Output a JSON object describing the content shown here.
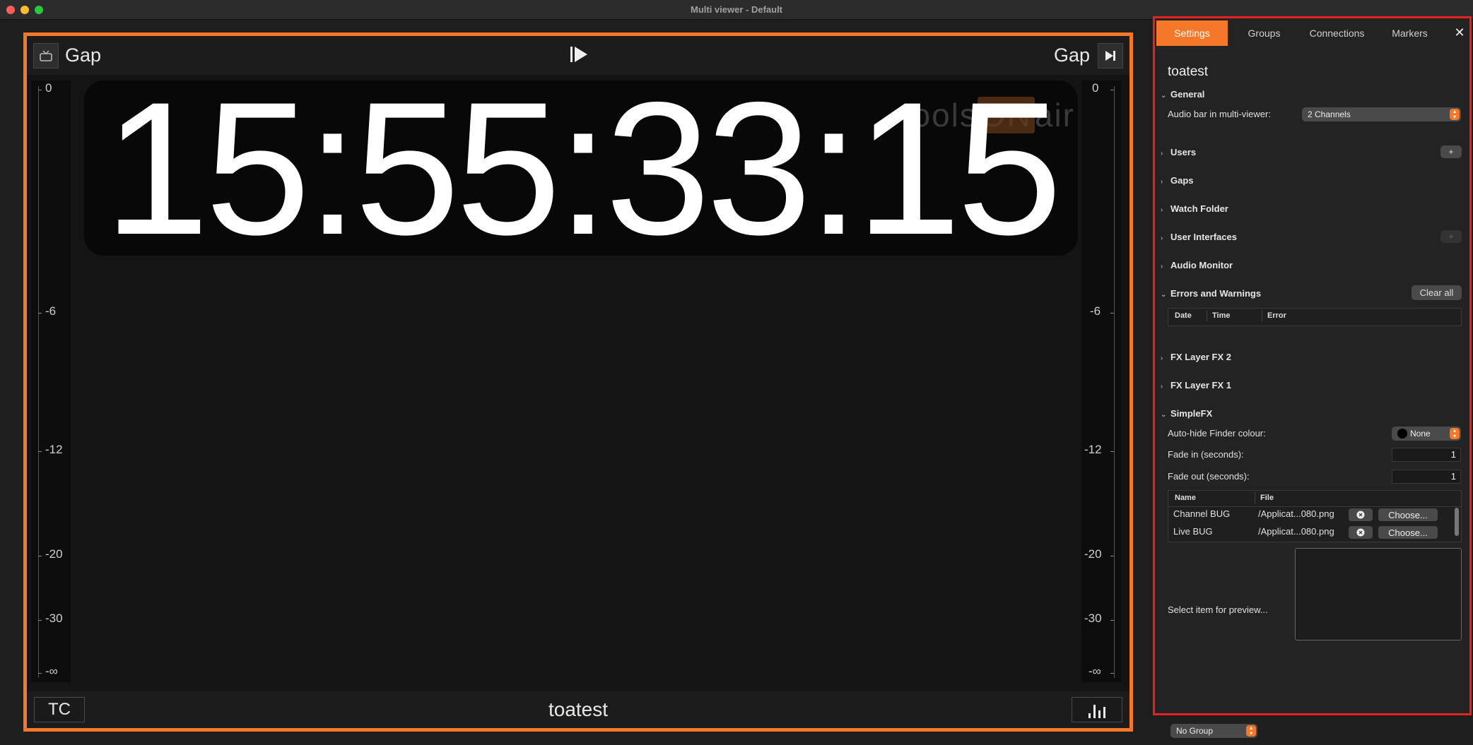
{
  "window": {
    "title": "Multi viewer - Default"
  },
  "viewer": {
    "left_label": "Gap",
    "right_label": "Gap",
    "timecode": "15:55:33:15",
    "watermark": {
      "pre": "tools",
      "on": "ON",
      "post": "air"
    },
    "bottom_left": "TC",
    "bottom_name": "toatest",
    "meter_ticks": [
      "0",
      "-6",
      "-12",
      "-20",
      "-30",
      "-∞"
    ]
  },
  "panel": {
    "tabs": [
      "Settings",
      "Groups",
      "Connections",
      "Markers"
    ],
    "active_tab": "Settings",
    "title": "toatest",
    "sections": {
      "general": "General",
      "users": "Users",
      "gaps": "Gaps",
      "watch_folder": "Watch Folder",
      "user_interfaces": "User Interfaces",
      "audio_monitor": "Audio Monitor",
      "errors": "Errors and Warnings",
      "fx2": "FX Layer FX 2",
      "fx1": "FX Layer FX 1",
      "simplefx": "SimpleFX"
    },
    "general": {
      "audio_bar_label": "Audio bar in multi-viewer:",
      "audio_bar_value": "2 Channels"
    },
    "users_add": "+",
    "ui_add": "+",
    "errors": {
      "clear_all": "Clear all",
      "columns": [
        "Date",
        "Time",
        "Error"
      ]
    },
    "simplefx": {
      "autohide_label": "Auto-hide Finder colour:",
      "autohide_value": "None",
      "fade_in_label": "Fade in (seconds):",
      "fade_in_value": "1",
      "fade_out_label": "Fade out (seconds):",
      "fade_out_value": "1",
      "columns": [
        "Name",
        "File"
      ],
      "rows": [
        {
          "name": "Channel BUG",
          "file": "/Applicat...080.png",
          "choose": "Choose..."
        },
        {
          "name": "Live BUG",
          "file": "/Applicat...080.png",
          "choose": "Choose..."
        }
      ],
      "preview_label": "Select item for preview..."
    }
  },
  "group_select": {
    "value": "No Group"
  },
  "colors": {
    "accent": "#f5782a",
    "panel_border": "#e52222"
  }
}
